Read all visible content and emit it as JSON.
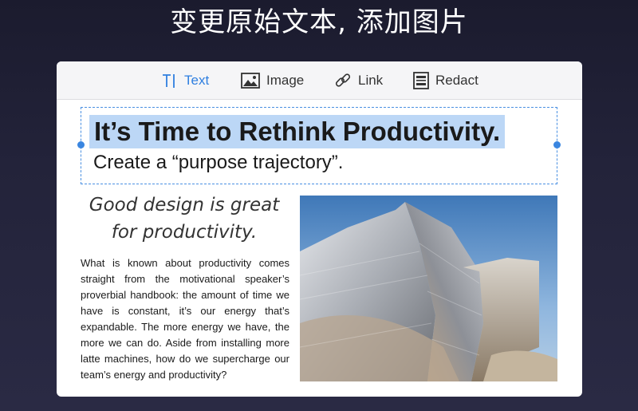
{
  "headline": "变更原始文本, 添加图片",
  "toolbar": {
    "tools": [
      {
        "label": "Text",
        "icon": "text-cursor-icon",
        "active": true
      },
      {
        "label": "Image",
        "icon": "image-icon",
        "active": false
      },
      {
        "label": "Link",
        "icon": "link-icon",
        "active": false
      },
      {
        "label": "Redact",
        "icon": "redact-icon",
        "active": false
      }
    ]
  },
  "document": {
    "title": "It’s Time to Rethink Productivity.",
    "subtitle": "Create a “purpose trajectory”.",
    "pull_quote": "Good design is great for productivity.",
    "body": "What is known about productivity comes straight from the motivational speaker’s proverbial handbook: the amount of time we have is constant, it’s our energy that’s expandable. The more energy we have, the more we can do. Aside from installing more latte machines, how do we supercharge our team’s energy and productivity?"
  },
  "colors": {
    "accent": "#2f7fe0",
    "selection": "#bcd7f6",
    "background": "#1b1b2e"
  }
}
